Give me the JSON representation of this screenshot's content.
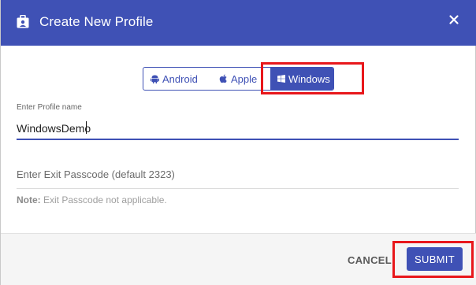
{
  "dialog": {
    "title": "Create New Profile",
    "header_icon": "profile-badge-icon",
    "close_icon": "close-icon"
  },
  "platforms": {
    "items": [
      {
        "label": "Android",
        "icon": "android-icon"
      },
      {
        "label": "Apple",
        "icon": "apple-icon"
      },
      {
        "label": "Windows",
        "icon": "windows-icon"
      }
    ],
    "selected": "Windows"
  },
  "profile_name": {
    "label": "Enter Profile name",
    "value": "WindowsDemo"
  },
  "exit_passcode": {
    "placeholder": "Enter Exit Passcode (default 2323)",
    "value": ""
  },
  "note": {
    "prefix": "Note:",
    "text": " Exit Passcode not applicable."
  },
  "footer": {
    "cancel_label": "CANCEL",
    "submit_label": "SUBMIT"
  },
  "colors": {
    "primary": "#3f51b5",
    "highlight": "#e8171b"
  }
}
